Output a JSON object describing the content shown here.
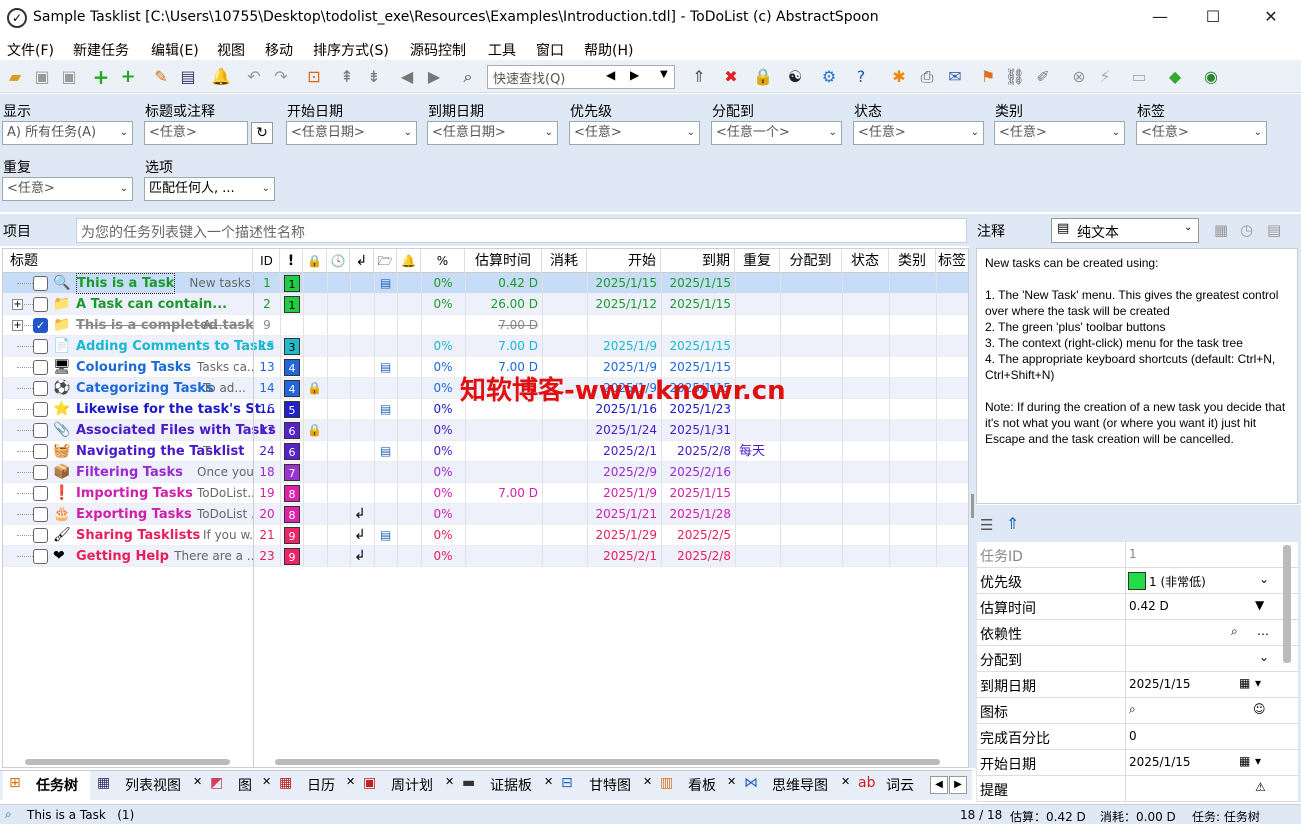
{
  "window": {
    "title": "Sample Tasklist [C:\\Users\\10755\\Desktop\\todolist_exe\\Resources\\Examples\\Introduction.tdl] - ToDoList (c) AbstractSpoon",
    "minimize": "—",
    "maximize": "☐",
    "close": "✕"
  },
  "menu": [
    "文件(F)",
    "新建任务",
    "编辑(E)",
    "视图",
    "移动",
    "排序方式(S)",
    "源码控制",
    "工具",
    "窗口",
    "帮助(H)"
  ],
  "quickfind": {
    "placeholder": "快速查找(Q)"
  },
  "filters": {
    "show": {
      "label": "显示",
      "value": "A) 所有任务(A)"
    },
    "title": {
      "label": "标题或注释",
      "value": "<任意>"
    },
    "start": {
      "label": "开始日期",
      "value": "<任意日期>"
    },
    "due": {
      "label": "到期日期",
      "value": "<任意日期>"
    },
    "priority": {
      "label": "优先级",
      "value": "<任意>"
    },
    "alloc": {
      "label": "分配到",
      "value": "<任意一个>"
    },
    "status": {
      "label": "状态",
      "value": "<任意>"
    },
    "category": {
      "label": "类别",
      "value": "<任意>"
    },
    "tags": {
      "label": "标签",
      "value": "<任意>"
    },
    "recur": {
      "label": "重复",
      "value": "<任意>"
    },
    "options": {
      "label": "选项",
      "value": "匹配任何人, ..."
    }
  },
  "project": {
    "label": "项目",
    "placeholder": "为您的任务列表键入一个描述性名称"
  },
  "columns": [
    "标题",
    "ID",
    "!",
    "🔒",
    "🕓",
    "↲",
    "🗁",
    "🔔",
    "%",
    "估算时间",
    "消耗",
    "开始",
    "到期",
    "重复",
    "分配到",
    "状态",
    "类别",
    "标签"
  ],
  "tasks": [
    {
      "title": "This is a Task",
      "note": "New tasks c...",
      "id": "1",
      "prio": "1",
      "pc": "#22cc44",
      "pct": "0%",
      "est": "0.42 D",
      "start": "2025/1/15",
      "due": "2025/1/15",
      "recur": "",
      "color": "#1a9a2a",
      "icon": "🔍",
      "sel": true,
      "done": false,
      "exp": ""
    },
    {
      "title": "A Task can contain...",
      "note": "",
      "id": "2",
      "prio": "1",
      "pc": "#22cc44",
      "pct": "0%",
      "est": "26.00 D",
      "start": "2025/1/12",
      "due": "2025/1/15",
      "recur": "",
      "color": "#1a9a2a",
      "icon": "📁",
      "exp": "+"
    },
    {
      "title": "This is a completed task",
      "note": "A...",
      "id": "9",
      "prio": "",
      "pc": "",
      "pct": "",
      "est": "7.00 D",
      "start": "",
      "due": "",
      "recur": "",
      "color": "#888",
      "icon": "📁",
      "done": true,
      "exp": "+"
    },
    {
      "title": "Adding Comments to Tasks",
      "note": "",
      "id": "15",
      "prio": "3",
      "pc": "#22bbcc",
      "pct": "0%",
      "est": "7.00 D",
      "start": "2025/1/9",
      "due": "2025/1/15",
      "recur": "",
      "color": "#18b8d0",
      "icon": "📄"
    },
    {
      "title": "Colouring Tasks",
      "note": "Tasks ca...",
      "id": "13",
      "prio": "4",
      "pc": "#2266dd",
      "pct": "0%",
      "est": "7.00 D",
      "start": "2025/1/9",
      "due": "2025/1/15",
      "recur": "",
      "color": "#1a6ad8",
      "icon": "🖥"
    },
    {
      "title": "Categorizing Tasks",
      "note": "To ad...",
      "id": "14",
      "prio": "4",
      "pc": "#2266dd",
      "pct": "0%",
      "est": "",
      "start": "2025/1/9",
      "due": "2025/1/15",
      "recur": "",
      "color": "#1a6ad8",
      "icon": "⚽"
    },
    {
      "title": "Likewise for the task's St...",
      "note": "",
      "id": "16",
      "prio": "5",
      "pc": "#2222cc",
      "pct": "0%",
      "est": "",
      "start": "2025/1/16",
      "due": "2025/1/23",
      "recur": "",
      "color": "#1a1ac8",
      "icon": "⭐"
    },
    {
      "title": "Associated Files with Tasks",
      "note": "",
      "id": "17",
      "prio": "6",
      "pc": "#5522cc",
      "pct": "0%",
      "est": "",
      "start": "2025/1/24",
      "due": "2025/1/31",
      "recur": "",
      "color": "#4a1ac8",
      "icon": "📎"
    },
    {
      "title": "Navigating the Tasklist",
      "note": "T...",
      "id": "24",
      "prio": "6",
      "pc": "#5522cc",
      "pct": "0%",
      "est": "",
      "start": "2025/2/1",
      "due": "2025/2/8",
      "recur": "每天",
      "color": "#4a1ac8",
      "icon": "🧺"
    },
    {
      "title": "Filtering Tasks",
      "note": "Once you h...",
      "id": "18",
      "prio": "7",
      "pc": "#9933cc",
      "pct": "0%",
      "est": "",
      "start": "2025/2/9",
      "due": "2025/2/16",
      "recur": "",
      "color": "#9a2ad0",
      "icon": "📦"
    },
    {
      "title": "Importing Tasks",
      "note": "ToDoList...",
      "id": "19",
      "prio": "8",
      "pc": "#dd22aa",
      "pct": "0%",
      "est": "7.00 D",
      "start": "2025/1/9",
      "due": "2025/1/15",
      "recur": "",
      "color": "#d020a8",
      "icon": "❗"
    },
    {
      "title": "Exporting Tasks",
      "note": "ToDoList ...",
      "id": "20",
      "prio": "8",
      "pc": "#dd22aa",
      "pct": "0%",
      "est": "",
      "start": "2025/1/21",
      "due": "2025/1/28",
      "recur": "",
      "color": "#d020a8",
      "icon": "🎂"
    },
    {
      "title": "Sharing Tasklists",
      "note": "If you w...",
      "id": "21",
      "prio": "9",
      "pc": "#ee2266",
      "pct": "0%",
      "est": "",
      "start": "2025/1/29",
      "due": "2025/2/5",
      "recur": "",
      "color": "#e8205a",
      "icon": "🖌"
    },
    {
      "title": "Getting Help",
      "note": "There are a ...",
      "id": "23",
      "prio": "9",
      "pc": "#ee2266",
      "pct": "0%",
      "est": "",
      "start": "2025/2/1",
      "due": "2025/2/8",
      "recur": "",
      "color": "#e8205a",
      "icon": "❤"
    }
  ],
  "notes": {
    "label": "注释",
    "format": "纯文本",
    "text": "New tasks can be created using:\n\n1. The 'New Task' menu. This gives the greatest control over where the task will be created\n2. The green 'plus' toolbar buttons\n3. The context (right-click) menu for the task tree\n4. The appropriate keyboard shortcuts (default: Ctrl+N, Ctrl+Shift+N)\n\nNote: If during the creation of a new task you decide that it's not what you want (or where you want it) just hit Escape and the task creation will be cancelled."
  },
  "props": [
    {
      "k": "任务ID",
      "v": "1"
    },
    {
      "k": "优先级",
      "v": "1 (非常低)"
    },
    {
      "k": "估算时间",
      "v": "0.42 D"
    },
    {
      "k": "依赖性",
      "v": ""
    },
    {
      "k": "分配到",
      "v": ""
    },
    {
      "k": "到期日期",
      "v": "2025/1/15"
    },
    {
      "k": "图标",
      "v": ""
    },
    {
      "k": "完成百分比",
      "v": "0"
    },
    {
      "k": "开始日期",
      "v": "2025/1/15"
    },
    {
      "k": "提醒",
      "v": ""
    }
  ],
  "tabs": [
    "任务树",
    "列表视图",
    "图",
    "日历",
    "周计划",
    "证据板",
    "甘特图",
    "看板",
    "思维导图",
    "词云"
  ],
  "status": {
    "left": "This is a Task   (1)",
    "count": "18 / 18",
    "est": "估算：0.42 D",
    "spent": "消耗：0.00 D",
    "view": "任务: 任务树"
  },
  "watermark": "知软博客-www.knowr.cn"
}
